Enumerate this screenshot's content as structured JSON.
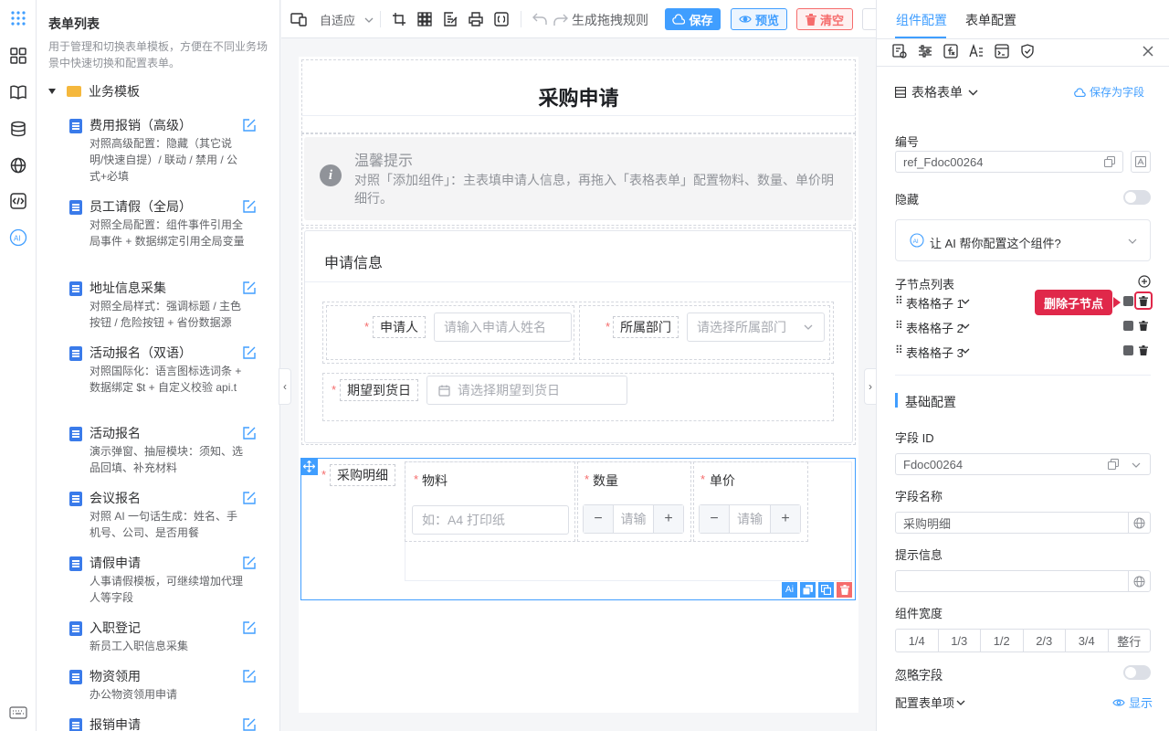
{
  "sidebar": {
    "title": "表单列表",
    "description": "用于管理和切换表单模板，方便在不同业务场景中快速切换和配置表单。",
    "group": "业务模板",
    "templates": [
      {
        "name": "费用报销（高级）",
        "desc": "对照高级配置：隐藏（其它说明/快速自提）/ 联动 / 禁用 / 公式+必填"
      },
      {
        "name": "员工请假（全局）",
        "desc": "对照全局配置：组件事件引用全局事件 + 数据绑定引用全局变量"
      },
      {
        "name": "地址信息采集",
        "desc": "对照全局样式：强调标题 / 主色按钮 / 危险按钮 + 省份数据源"
      },
      {
        "name": "活动报名（双语）",
        "desc": "对照国际化：语言图标选词条 + 数据绑定 $t + 自定义校验 api.t"
      },
      {
        "name": "活动报名",
        "desc": "演示弹窗、抽屉模块：须知、选品回填、补充材料"
      },
      {
        "name": "会议报名",
        "desc": "对照 AI 一句话生成：姓名、手机号、公司、是否用餐"
      },
      {
        "name": "请假申请",
        "desc": "人事请假模板，可继续增加代理人等字段"
      },
      {
        "name": "入职登记",
        "desc": "新员工入职信息采集"
      },
      {
        "name": "物资领用",
        "desc": "办公物资领用申请"
      },
      {
        "name": "报销申请",
        "desc": ""
      }
    ]
  },
  "toolbar": {
    "mode": "自适应",
    "generate_rule": "生成拖拽规则",
    "save": "保存",
    "preview": "预览",
    "clear": "清空"
  },
  "form": {
    "title": "采购申请",
    "tip_title": "温馨提示",
    "tip_body": "对照「添加组件」：主表填申请人信息，再拖入「表格表单」配置物料、数量、单价明细行。",
    "section_title": "申请信息",
    "applicant_label": "申请人",
    "applicant_placeholder": "请输入申请人姓名",
    "dept_label": "所属部门",
    "dept_placeholder": "请选择所属部门",
    "date_label": "期望到货日",
    "date_placeholder": "请选择期望到货日",
    "detail_label": "采购明细",
    "col_material": "物料",
    "col_qty": "数量",
    "col_price": "单价",
    "material_placeholder": "如：A4 打印纸",
    "qty_placeholder": "请输",
    "price_placeholder": "请输",
    "minus": "−",
    "plus": "+",
    "ai_badge": "Ai"
  },
  "right": {
    "tab_component": "组件配置",
    "tab_form": "表单配置",
    "component_type": "表格表单",
    "save_as_field": "保存为字段",
    "code_label": "编号",
    "code_value": "ref_Fdoc00264",
    "hidden_label": "隐藏",
    "ai_prompt": "让 AI 帮你配置这个组件?",
    "children_label": "子节点列表",
    "children": [
      "表格格子 1",
      "表格格子 2",
      "表格格子 3"
    ],
    "tooltip": "删除子节点",
    "basic_title": "基础配置",
    "field_id_label": "字段 ID",
    "field_id_value": "Fdoc00264",
    "field_name_label": "字段名称",
    "field_name_value": "采购明细",
    "hint_label": "提示信息",
    "width_label": "组件宽度",
    "width_options": [
      "1/4",
      "1/3",
      "1/2",
      "2/3",
      "3/4",
      "整行"
    ],
    "ignore_label": "忽略字段",
    "config_items_label": "配置表单项",
    "show_label": "显示"
  },
  "colors": {
    "primary": "#409eff",
    "danger": "#f56c6c",
    "tooltip": "#e0284a"
  }
}
